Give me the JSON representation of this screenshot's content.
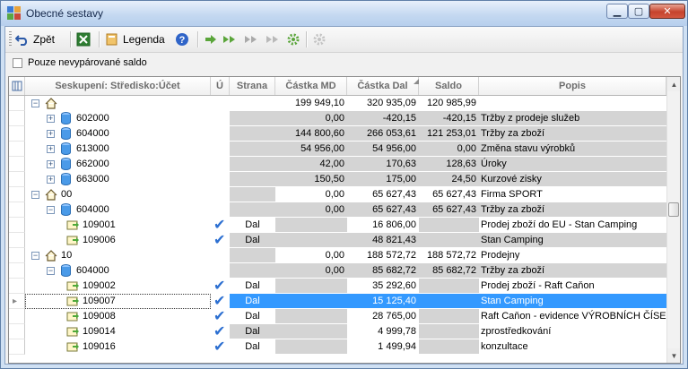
{
  "window": {
    "title": "Obecné sestavy",
    "controls": [
      "minimize",
      "maximize",
      "close"
    ]
  },
  "toolbar": {
    "back_label": "Zpět",
    "excel_icon": "excel-icon",
    "legend_label": "Legenda",
    "nav_icons": [
      "arrow-right-icon",
      "double-arrow-right-icon",
      "double-arrow-right-disabled-icon",
      "double-arrow-right-disabled-icon",
      "gear-icon",
      "gear-disabled-icon"
    ]
  },
  "filter": {
    "checkbox_label": "Pouze nevypárované saldo",
    "checked": false
  },
  "grid": {
    "columns": {
      "group": "Seskupení: Středisko:Účet",
      "u": "Ú",
      "strana": "Strana",
      "md": "Částka MD",
      "dal": "Částka Dal",
      "saldo": "Saldo",
      "popis": "Popis"
    },
    "rows": [
      {
        "level": 0,
        "type": "group",
        "label": "",
        "md": "199 949,10",
        "dal": "320 935,09",
        "saldo": "120 985,99",
        "popis": ""
      },
      {
        "level": 1,
        "type": "account",
        "label": "602000",
        "md": "0,00",
        "dal": "-420,15",
        "saldo": "-420,15",
        "popis": "Tržby z prodeje služeb"
      },
      {
        "level": 1,
        "type": "account",
        "label": "604000",
        "md": "144 800,60",
        "dal": "266 053,61",
        "saldo": "121 253,01",
        "popis": "Tržby za zboží"
      },
      {
        "level": 1,
        "type": "account",
        "label": "613000",
        "md": "54 956,00",
        "dal": "54 956,00",
        "saldo": "0,00",
        "popis": "Změna stavu výrobků"
      },
      {
        "level": 1,
        "type": "account",
        "label": "662000",
        "md": "42,00",
        "dal": "170,63",
        "saldo": "128,63",
        "popis": "Úroky"
      },
      {
        "level": 1,
        "type": "account",
        "label": "663000",
        "md": "150,50",
        "dal": "175,00",
        "saldo": "24,50",
        "popis": "Kurzové zisky"
      },
      {
        "level": 0,
        "type": "group",
        "label": "00",
        "md": "0,00",
        "dal": "65 627,43",
        "saldo": "65 627,43",
        "popis": "Firma SPORT"
      },
      {
        "level": 1,
        "type": "account",
        "label": "604000",
        "md": "0,00",
        "dal": "65 627,43",
        "saldo": "65 627,43",
        "popis": "Tržby za zboží"
      },
      {
        "level": 2,
        "type": "doc",
        "label": "109001",
        "checked": true,
        "strana": "Dal",
        "md": "",
        "dal": "16 806,00",
        "saldo": "",
        "popis": "Prodej zboží do EU - Stan Camping"
      },
      {
        "level": 2,
        "type": "doc",
        "label": "109006",
        "checked": true,
        "strana": "Dal",
        "md": "",
        "dal": "48 821,43",
        "saldo": "",
        "popis": "Stan Camping"
      },
      {
        "level": 0,
        "type": "group",
        "label": "10",
        "md": "0,00",
        "dal": "188 572,72",
        "saldo": "188 572,72",
        "popis": "Prodejny"
      },
      {
        "level": 1,
        "type": "account",
        "label": "604000",
        "md": "0,00",
        "dal": "85 682,72",
        "saldo": "85 682,72",
        "popis": "Tržby za zboží"
      },
      {
        "level": 2,
        "type": "doc",
        "label": "109002",
        "checked": true,
        "strana": "Dal",
        "md": "",
        "dal": "35 292,60",
        "saldo": "",
        "popis": "Prodej zboží - Raft Caňon"
      },
      {
        "level": 2,
        "type": "doc",
        "label": "109007",
        "checked": true,
        "strana": "Dal",
        "md": "",
        "dal": "15 125,40",
        "saldo": "",
        "popis": "Stan Camping",
        "selected": true
      },
      {
        "level": 2,
        "type": "doc",
        "label": "109008",
        "checked": true,
        "strana": "Dal",
        "md": "",
        "dal": "28 765,00",
        "saldo": "",
        "popis": "Raft Caňon - evidence VÝROBNÍCH ČÍSEL"
      },
      {
        "level": 2,
        "type": "doc",
        "label": "109014",
        "checked": true,
        "strana": "Dal",
        "md": "",
        "dal": "4 999,78",
        "saldo": "",
        "popis": "zprostředkování"
      },
      {
        "level": 2,
        "type": "doc",
        "label": "109016",
        "checked": true,
        "strana": "Dal",
        "md": "",
        "dal": "1 499,94",
        "saldo": "",
        "popis": "konzultace"
      }
    ]
  }
}
